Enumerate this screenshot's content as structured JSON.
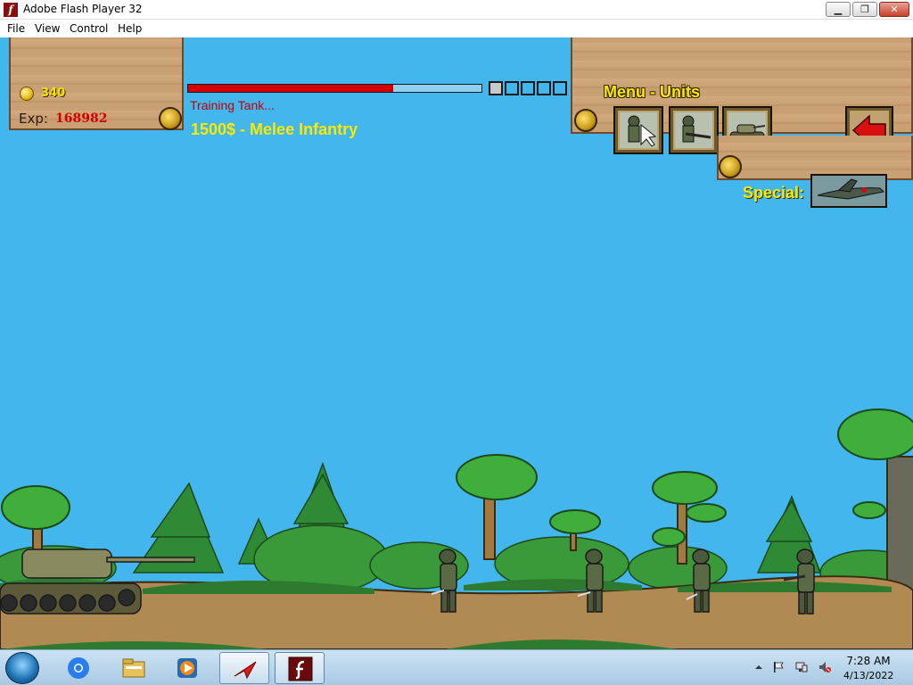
{
  "window": {
    "title": "Adobe Flash Player 32",
    "controls": {
      "minimize": "▁",
      "maximize": "❐",
      "close": "✕"
    }
  },
  "menubar": {
    "items": [
      "File",
      "View",
      "Control",
      "Help"
    ]
  },
  "hud": {
    "gold": "340",
    "exp_label": "Exp:",
    "exp_value": "168982",
    "training_progress": 0.7,
    "queue_slots": [
      {
        "filled": true
      },
      {
        "filled": false
      },
      {
        "filled": false
      },
      {
        "filled": false
      },
      {
        "filled": false
      }
    ],
    "training_text": "Training Tank...",
    "unit_info": "1500$ - Melee Infantry"
  },
  "menu": {
    "title": "Menu - Units",
    "units": [
      {
        "name": "melee-infantry",
        "icon": "soldier-with-cursor-icon"
      },
      {
        "name": "rifle-infantry",
        "icon": "rifleman-icon"
      },
      {
        "name": "tank",
        "icon": "tank-icon"
      }
    ],
    "back_icon": "back-arrow-icon",
    "special_label": "Special:",
    "special_icon": "airstrike-plane-icon"
  },
  "colors": {
    "sky": "#44b6ee",
    "hud_yellow": "#f8ea00",
    "exp_red": "#d10000",
    "progress_red": "#d40000",
    "training_red": "#c00000"
  },
  "taskbar": {
    "apps": [
      "chrome-icon",
      "file-explorer-icon",
      "media-player-icon",
      "flash-app-icon",
      "flash-player-icon"
    ],
    "time": "7:28 AM",
    "date": "4/13/2022"
  }
}
